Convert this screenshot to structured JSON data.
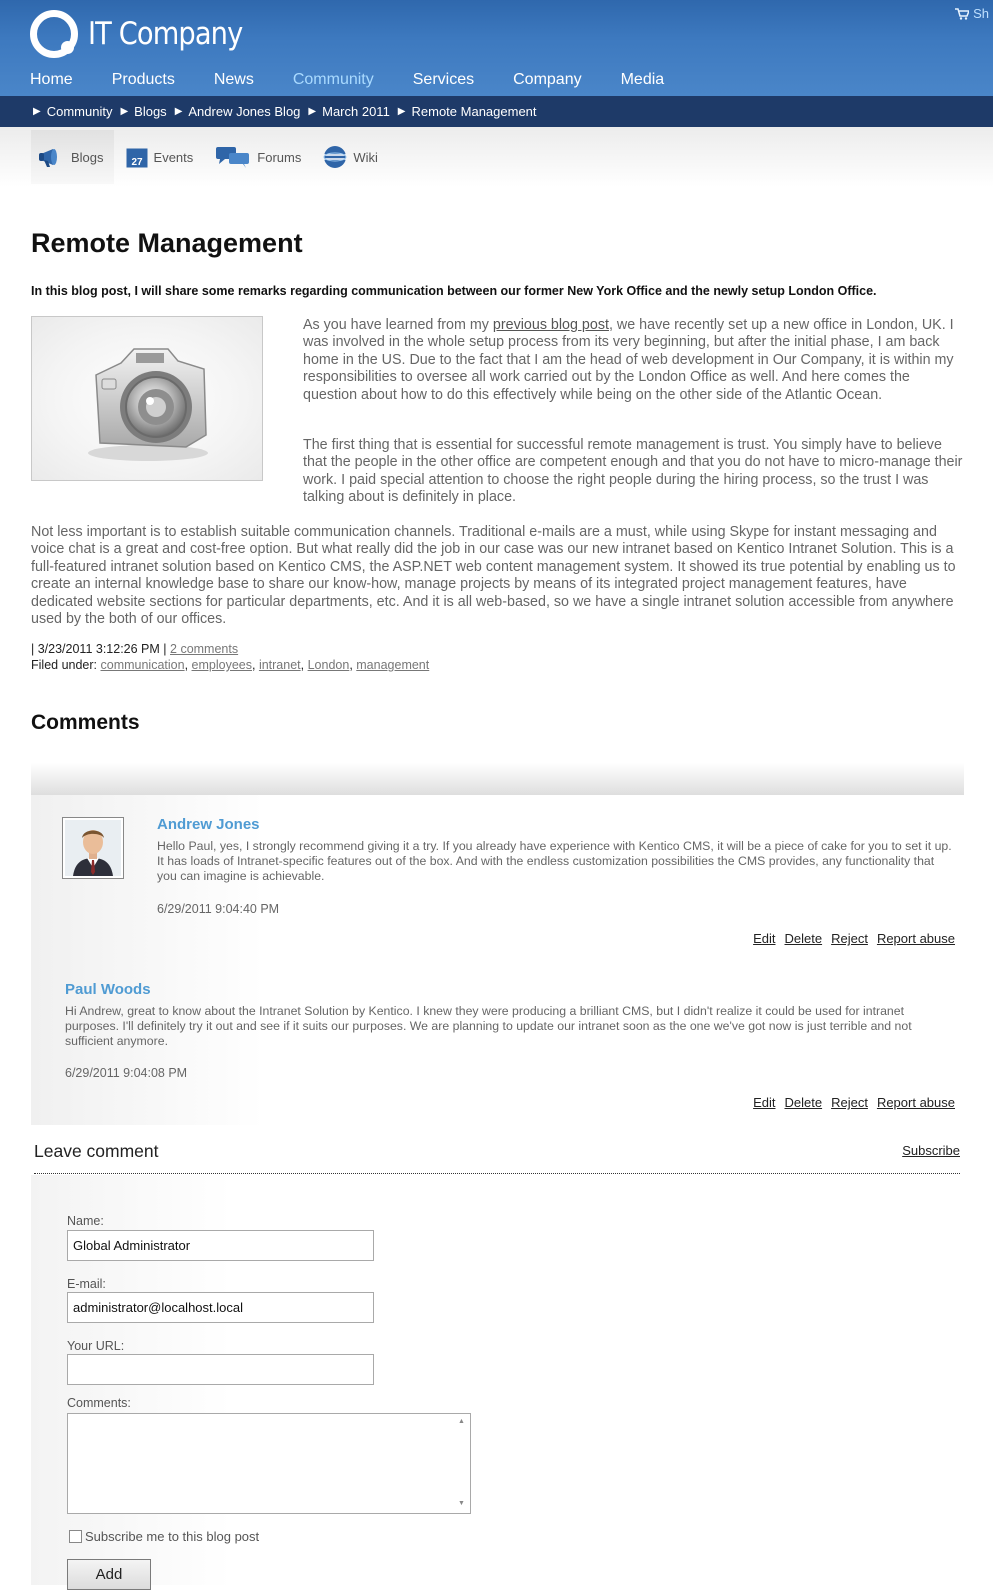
{
  "header": {
    "logo_text": "IT Company",
    "cart_text": "Sh",
    "nav": [
      "Home",
      "Products",
      "News",
      "Community",
      "Services",
      "Company",
      "Media"
    ],
    "active_nav": "Community"
  },
  "breadcrumb": [
    "Community",
    "Blogs",
    "Andrew Jones Blog",
    "March 2011",
    "Remote Management"
  ],
  "subtabs": [
    {
      "label": "Blogs",
      "icon": "megaphone-icon",
      "active": true
    },
    {
      "label": "Events",
      "icon": "calendar-icon",
      "calendar_day": "27",
      "active": false
    },
    {
      "label": "Forums",
      "icon": "chat-bubbles-icon",
      "active": false
    },
    {
      "label": "Wiki",
      "icon": "globe-icon",
      "active": false
    }
  ],
  "article": {
    "title": "Remote Management",
    "lead": "In this blog post, I will share some remarks regarding communication between our former New York Office and the newly setup London Office.",
    "p1_before": "As you have learned from my ",
    "p1_link": "previous blog post",
    "p1_after": ", we have recently set up a new office in London, UK. I was involved in the whole setup process from its very beginning, but after the initial phase, I am back home in the US. Due to the fact that I am the head of web development in Our Company, it is within my responsibilities to oversee all work carried out by the London Office as well. And here comes the question about how to do this effectively while being on the other side of the Atlantic Ocean.",
    "p2": "The first thing that is essential for successful remote management is trust. You simply have to believe that the people in the other office are competent enough and that you do not have to micro-manage their work. I paid special attention to choose the right people during the hiring process, so the trust I was talking about is definitely in place.",
    "p3": "Not less important is to establish suitable communication channels. Traditional e-mails are a must, while using Skype for instant messaging and voice chat is a great and cost-free option. But what really did the job in our case was our new intranet based on Kentico Intranet Solution. This is a full-featured intranet solution based on Kentico CMS, the ASP.NET web content management system. It showed its true potential by enabling us to create an internal knowledge base to share our know-how, manage projects by means of its integrated project management features, have dedicated website sections for particular departments, etc. And it is all web-based, so we have a single intranet solution accessible from anywhere used by the both of our offices.",
    "date_line": "| 3/23/2011 3:12:26 PM |",
    "comments_link": "2 comments",
    "filed_under_label": "Filed under:",
    "tags": [
      "communication",
      "employees",
      "intranet",
      "London",
      "management"
    ]
  },
  "comments_section": {
    "title": "Comments",
    "items": [
      {
        "author": "Andrew Jones",
        "text": "Hello Paul, yes, I strongly recommend giving it a try. If you already have experience with Kentico CMS, it will be a piece of cake for you to set it up. It has loads of Intranet-specific features out of the box. And with the endless customization possibilities the CMS provides, any functionality that you can imagine is achievable.",
        "date": "6/29/2011 9:04:40 PM",
        "has_avatar": true
      },
      {
        "author": "Paul Woods",
        "text": "Hi Andrew, great to know about the Intranet Solution by Kentico. I knew they were producing a brilliant CMS, but I didn't realize it could be used for intranet purposes. I'll definitely try it out and see if it suits our purposes. We are planning to update our intranet soon as the one we've got now is just terrible and not sufficient anymore.",
        "date": "6/29/2011 9:04:08 PM",
        "has_avatar": false
      }
    ],
    "actions": [
      "Edit",
      "Delete",
      "Reject",
      "Report abuse"
    ]
  },
  "leave_comment": {
    "title": "Leave comment",
    "subscribe_link": "Subscribe",
    "name_label": "Name:",
    "name_value": "Global Administrator",
    "email_label": "E-mail:",
    "email_value": "administrator@localhost.local",
    "url_label": "Your URL:",
    "url_value": "",
    "comments_label": "Comments:",
    "subscribe_checkbox_label": "Subscribe me to this blog post",
    "subscribe_checked": false,
    "add_button": "Add"
  }
}
